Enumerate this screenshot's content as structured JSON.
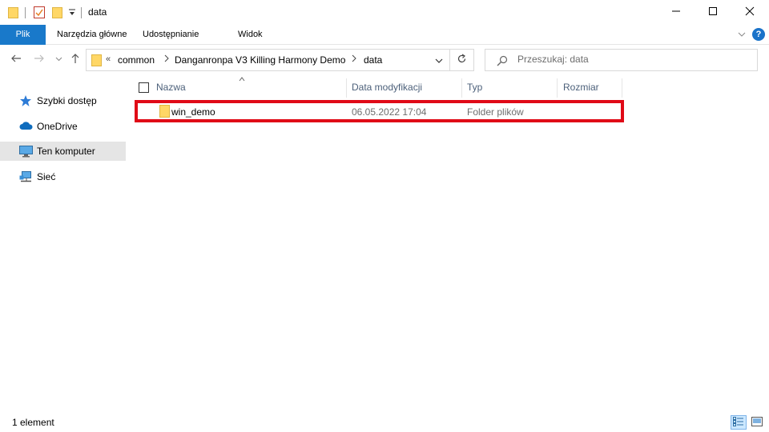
{
  "window": {
    "title": "data",
    "controls": {
      "minimize_icon": "minimize-icon",
      "maximize_icon": "maximize-icon",
      "close_icon": "close-icon"
    }
  },
  "ribbon": {
    "tabs": [
      {
        "label": "Plik",
        "active": true
      },
      {
        "label": "Narzędzia główne",
        "active": false
      },
      {
        "label": "Udostępnianie",
        "active": false
      },
      {
        "label": "Widok",
        "active": false
      }
    ],
    "help": "?"
  },
  "address": {
    "overflow": "«",
    "crumbs": [
      "common",
      "Danganronpa V3 Killing Harmony Demo",
      "data"
    ]
  },
  "search": {
    "placeholder": "Przeszukaj: data"
  },
  "nav": {
    "items": [
      {
        "label": "Szybki dostęp",
        "icon": "star-icon",
        "selected": false
      },
      {
        "label": "OneDrive",
        "icon": "cloud-icon",
        "selected": false
      },
      {
        "label": "Ten komputer",
        "icon": "computer-icon",
        "selected": true
      },
      {
        "label": "Sieć",
        "icon": "network-icon",
        "selected": false
      }
    ]
  },
  "columns": [
    "Nazwa",
    "Data modyfikacji",
    "Typ",
    "Rozmiar"
  ],
  "files": [
    {
      "name": "win_demo",
      "modified": "06.05.2022 17:04",
      "type": "Folder plików",
      "size": ""
    }
  ],
  "status": {
    "count": "1 element"
  },
  "colors": {
    "accent": "#1979ca",
    "highlight": "#e00a17",
    "folder": "#ffd766",
    "header_text": "#4c607a"
  }
}
